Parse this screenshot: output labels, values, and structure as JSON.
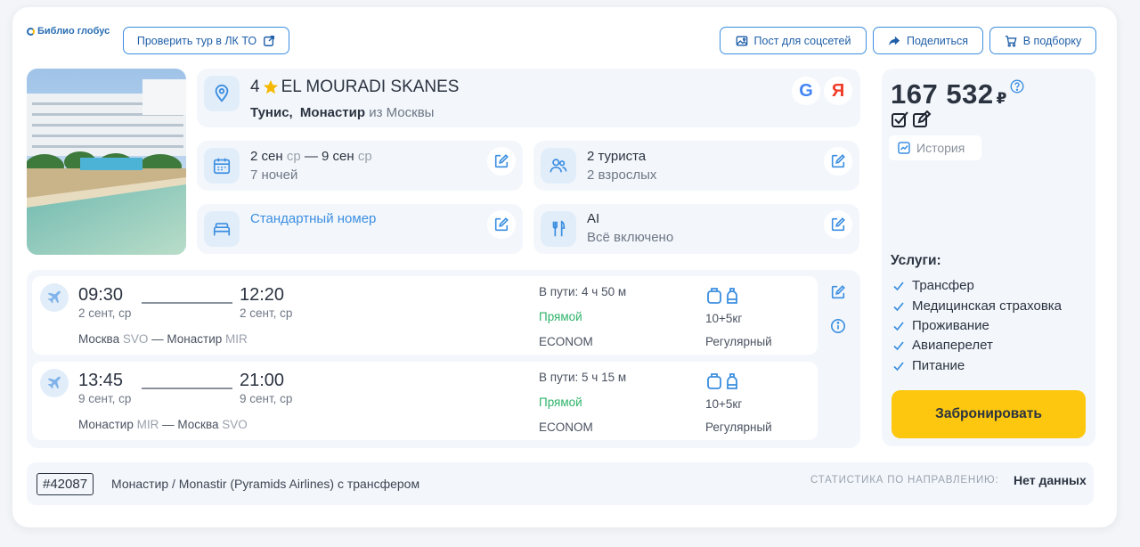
{
  "header": {
    "logo": "Библио глобус",
    "check_tour": "Проверить тур в ЛК ТО",
    "social_post": "Пост для соцсетей",
    "share": "Поделиться",
    "to_selection": "В подборку"
  },
  "hotel": {
    "stars": "4",
    "name": "EL MOURADI SKANES",
    "country": "Тунис,",
    "city": "Монастир",
    "from": "из Москвы",
    "google_badge": "G",
    "yandex_badge": "Я"
  },
  "dates": {
    "from": "2 сен",
    "from_dow": "ср",
    "sep": "—",
    "to": "9 сен",
    "to_dow": "ср",
    "nights": "7 ночей"
  },
  "tourists": {
    "count": "2 туриста",
    "detail": "2 взрослых"
  },
  "room": {
    "type": "Стандартный номер"
  },
  "meal": {
    "code": "AI",
    "name": "Всё включено"
  },
  "flights": [
    {
      "dep_time": "09:30",
      "dep_date": "2 сент, ср",
      "arr_time": "12:20",
      "arr_date": "2 сент, ср",
      "from_city": "Москва",
      "from_code": "SVO",
      "dash": "—",
      "to_city": "Монастир",
      "to_code": "MIR",
      "duration": "В пути: 4 ч 50 м",
      "direct": "Прямой",
      "class": "ECONOM",
      "baggage": "10+5кг",
      "kind": "Регулярный"
    },
    {
      "dep_time": "13:45",
      "dep_date": "9 сент, ср",
      "arr_time": "21:00",
      "arr_date": "9 сент, ср",
      "from_city": "Монастир",
      "from_code": "MIR",
      "dash": "—",
      "to_city": "Москва",
      "to_code": "SVO",
      "duration": "В пути: 5 ч 15 м",
      "direct": "Прямой",
      "class": "ECONOM",
      "baggage": "10+5кг",
      "kind": "Регулярный"
    }
  ],
  "pricing": {
    "price": "167 532",
    "currency": "₽",
    "history": "История",
    "services_title": "Услуги:",
    "services": [
      "Трансфер",
      "Медицинская страховка",
      "Проживание",
      "Авиаперелет",
      "Питание"
    ],
    "book": "Забронировать"
  },
  "footer": {
    "tour_id": "#42087",
    "description": "Монастир / Monastir (Pyramids Airlines) с трансфером",
    "stats_label": "СТАТИСТИКА ПО НАПРАВЛЕНИЮ:",
    "stats_value": "Нет данных"
  },
  "colors": {
    "accent": "#3b8ee0",
    "book": "#fcc70e",
    "direct": "#2fb36b",
    "star": "#f5b800"
  }
}
